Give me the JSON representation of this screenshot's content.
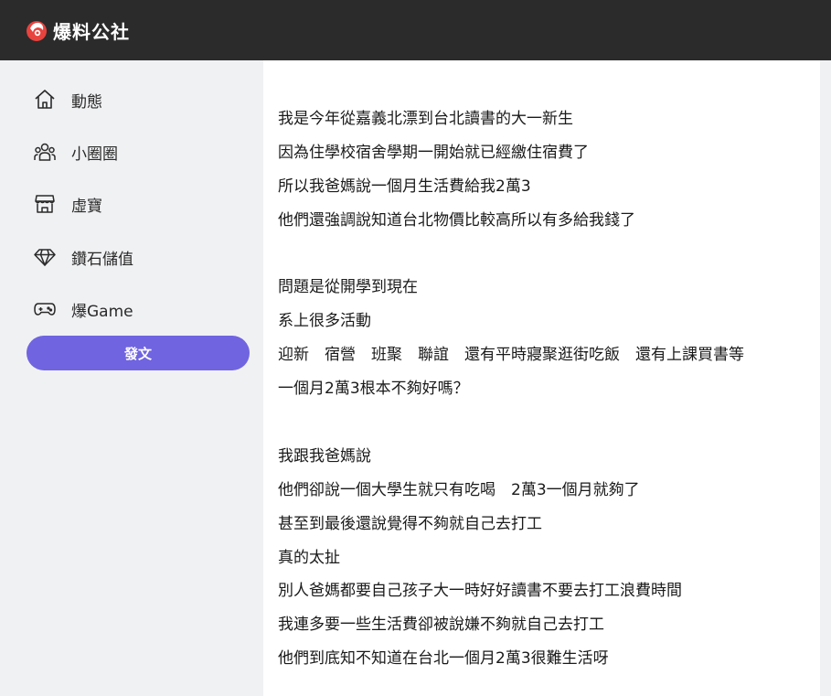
{
  "header": {
    "brand": "爆料公社"
  },
  "sidebar": {
    "items": [
      {
        "label": "動態",
        "icon": "home-icon"
      },
      {
        "label": "小圈圈",
        "icon": "group-icon"
      },
      {
        "label": "虛寶",
        "icon": "store-icon"
      },
      {
        "label": "鑽石儲值",
        "icon": "diamond-icon"
      },
      {
        "label": "爆Game",
        "icon": "gamepad-icon"
      }
    ],
    "post_button": "發文"
  },
  "article": {
    "lines": [
      "我是今年從嘉義北漂到台北讀書的大一新生",
      "因為住學校宿舍學期一開始就已經繳住宿費了",
      "所以我爸媽說一個月生活費給我2萬3",
      "他們還強調說知道台北物價比較高所以有多給我錢了",
      "",
      "問題是從開學到現在",
      "系上很多活動",
      "迎新　宿營　班聚　聯誼　還有平時寢聚逛街吃飯　還有上課買書等",
      "一個月2萬3根本不夠好嗎？",
      "",
      "我跟我爸媽說",
      "他們卻說一個大學生就只有吃喝　2萬3一個月就夠了",
      "甚至到最後還說覺得不夠就自己去打工",
      "真的太扯",
      "別人爸媽都要自己孩子大一時好好讀書不要去打工浪費時間",
      "我連多要一些生活費卻被說嫌不夠就自己去打工",
      "他們到底知不知道在台北一個月2萬3很難生活呀"
    ]
  },
  "colors": {
    "header_bg": "#2b2b2b",
    "accent": "#7064e0",
    "logo_red": "#e8433e"
  }
}
